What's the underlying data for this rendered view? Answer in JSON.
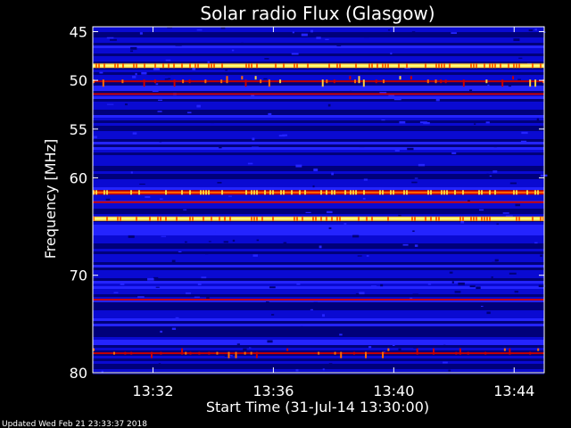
{
  "chart_data": {
    "type": "heatmap",
    "title": "Solar radio Flux (Glasgow)",
    "xlabel": "Start Time (31-Jul-14 13:30:00)",
    "ylabel": "Frequency [MHz]",
    "x_ticks": [
      "13:32",
      "13:36",
      "13:40",
      "13:44"
    ],
    "x_tick_minutes": [
      2,
      6,
      10,
      14
    ],
    "x_range_minutes": [
      0,
      15
    ],
    "y_ticks": [
      45,
      50,
      55,
      60,
      70,
      80
    ],
    "y_range_mhz": [
      44.5,
      80
    ],
    "colormap": [
      "#00007a",
      "#0a0ad2",
      "#2424ff",
      "#c80000",
      "#ff6a00",
      "#ffd040",
      "#ffff80"
    ],
    "emission_bands": [
      {
        "mhz": 48.5,
        "intensity": "very-high"
      },
      {
        "mhz": 50.1,
        "intensity": "high-intermittent"
      },
      {
        "mhz": 51.4,
        "intensity": "low"
      },
      {
        "mhz": 61.5,
        "intensity": "high"
      },
      {
        "mhz": 62.5,
        "intensity": "low"
      },
      {
        "mhz": 64.2,
        "intensity": "very-high"
      },
      {
        "mhz": 72.5,
        "intensity": "low"
      },
      {
        "mhz": 78.0,
        "intensity": "medium-intermittent"
      }
    ]
  },
  "footer": {
    "updated": "Updated Wed Feb 21 23:33:37 2018"
  },
  "colors": {
    "background": "#000000",
    "foreground": "#ffffff"
  }
}
